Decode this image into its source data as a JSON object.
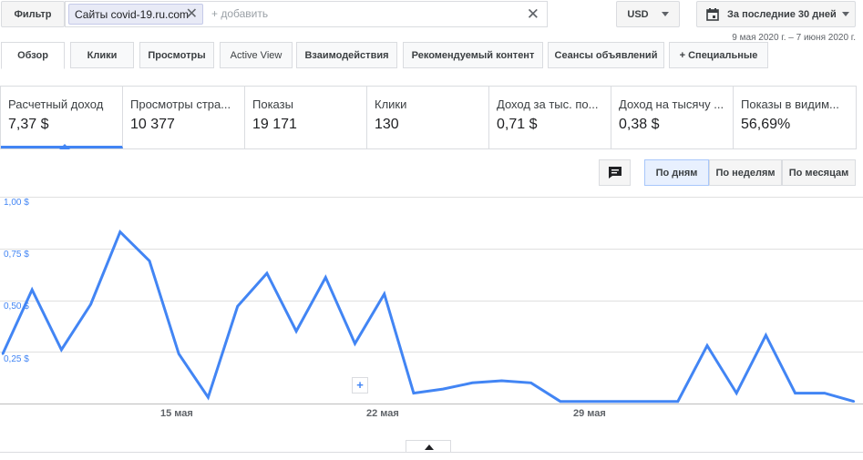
{
  "topbar": {
    "filter_label": "Фильтр",
    "chip_text": "Сайты covid-19.ru.com",
    "add_placeholder": "+ добавить",
    "currency": "USD",
    "period": "За последние 30 дней",
    "date_range": "9 мая 2020 г. – 7 июня 2020 г."
  },
  "tabs": [
    "Обзор",
    "Клики",
    "Просмотры",
    "Active View",
    "Взаимодействия",
    "Рекомендуемый контент",
    "Сеансы объявлений",
    "+ Специальные"
  ],
  "metrics": [
    {
      "label": "Расчетный доход",
      "value": "7,37 $"
    },
    {
      "label": "Просмотры стра...",
      "value": "10 377"
    },
    {
      "label": "Показы",
      "value": "19 171"
    },
    {
      "label": "Клики",
      "value": "130"
    },
    {
      "label": "Доход за тыс. по...",
      "value": "0,71 $"
    },
    {
      "label": "Доход на тысячу ...",
      "value": "0,38 $"
    },
    {
      "label": "Показы в видим...",
      "value": "56,69%"
    }
  ],
  "granularity": [
    "По дням",
    "По неделям",
    "По месяцам"
  ],
  "chart_data": {
    "type": "line",
    "y_ticks": [
      "1,00 $",
      "0,75 $",
      "0,50 $",
      "0,25 $"
    ],
    "x_ticks": [
      "15 мая",
      "22 мая",
      "29 мая"
    ],
    "ylim": [
      0,
      1
    ],
    "values": [
      0.24,
      0.55,
      0.26,
      0.48,
      0.83,
      0.69,
      0.24,
      0.03,
      0.47,
      0.63,
      0.35,
      0.61,
      0.29,
      0.53,
      0.05,
      0.07,
      0.1,
      0.11,
      0.1,
      0.01,
      0.01,
      0.01,
      0.01,
      0.01,
      0.28,
      0.05,
      0.33,
      0.05,
      0.05,
      0.01
    ],
    "color": "#4285f4"
  }
}
